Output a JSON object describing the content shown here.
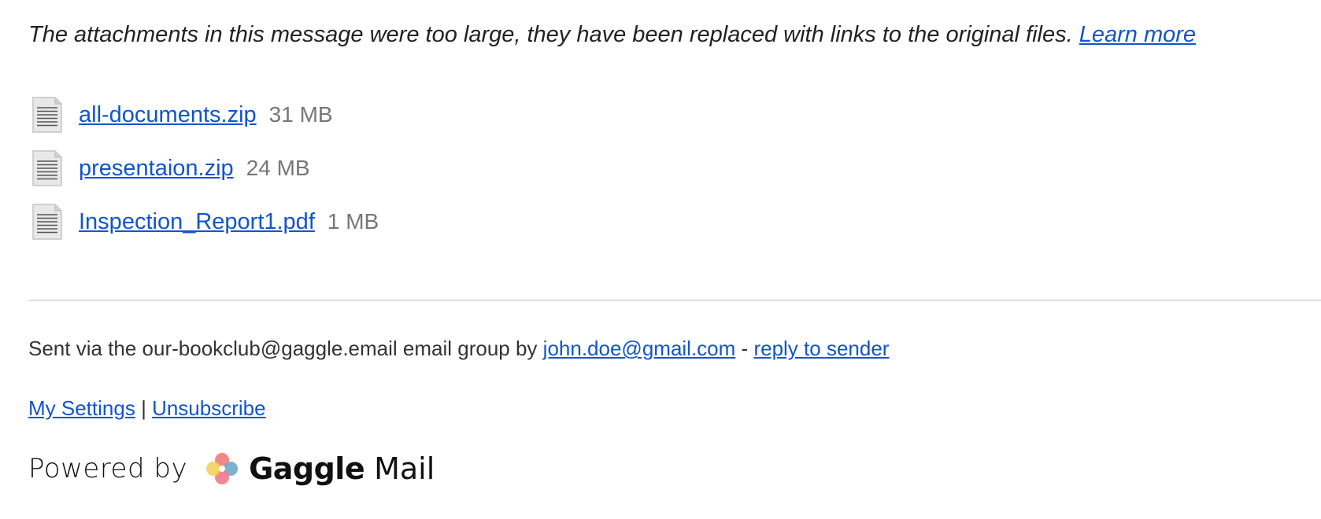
{
  "notice": {
    "text": "The attachments in this message were too large, they have been replaced with links to the original files.",
    "learn_more_label": "Learn more"
  },
  "attachments": [
    {
      "name": "all-documents.zip",
      "size": "31 MB",
      "icon": "document-icon"
    },
    {
      "name": "presentaion.zip",
      "size": "24 MB",
      "icon": "document-icon"
    },
    {
      "name": "Inspection_Report1.pdf",
      "size": "1 MB",
      "icon": "document-icon"
    }
  ],
  "footer": {
    "sent_via_text": "Sent via the our-bookclub@gaggle.email email group by",
    "sender_email": "john.doe@gmail.com",
    "dash": "-",
    "reply_label": "reply to sender",
    "my_settings_label": "My Settings",
    "separator": "|",
    "unsubscribe_label": "Unsubscribe"
  },
  "powered_by": {
    "text": "Powered by",
    "brand_bold": "Gaggle",
    "brand_light": "Mail",
    "logo_icon": "gaggle-logo-icon"
  },
  "colors": {
    "link": "#1155cc",
    "muted": "#777777",
    "divider": "#dddddd"
  }
}
